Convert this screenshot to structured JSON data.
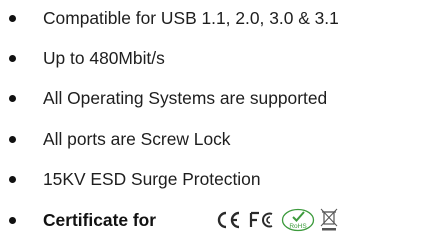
{
  "features": [
    "Compatible for USB 1.1, 2.0, 3.0 & 3.1",
    "Up to 480Mbit/s",
    "All Operating Systems are supported",
    "All ports are Screw Lock",
    "15KV ESD Surge Protection"
  ],
  "certificate": {
    "label": "Certificate for",
    "logos": {
      "ce": "CE",
      "fc": "FC",
      "rohs": "RoHS",
      "weee": "weee-bin-icon"
    }
  }
}
